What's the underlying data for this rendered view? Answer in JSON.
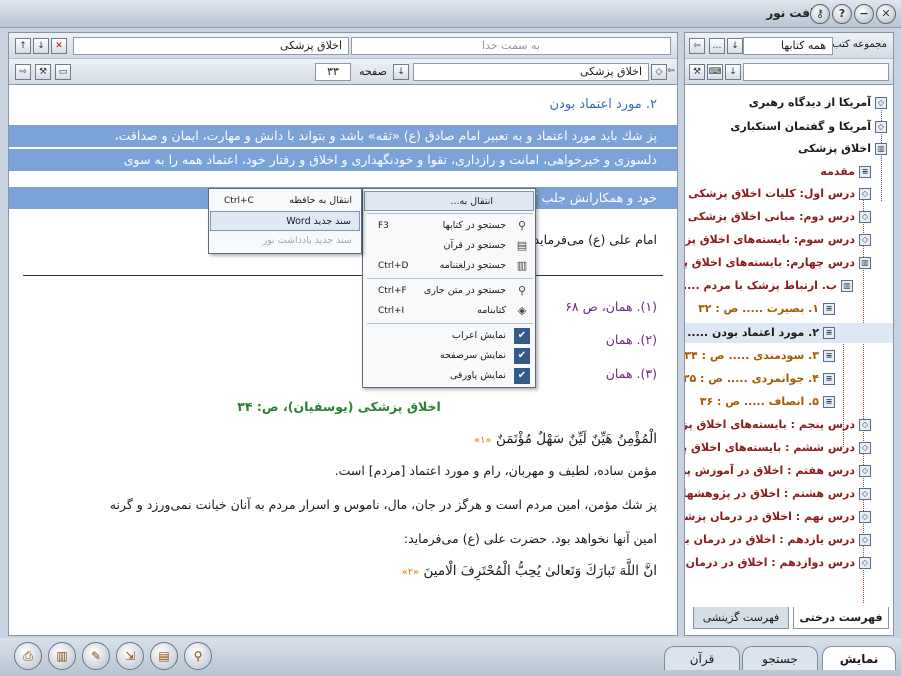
{
  "app": {
    "title": "ضیافت نور"
  },
  "reader": {
    "search_placeholder": "به سمت خدا",
    "book_title": "اخلاق پزشکی",
    "book_path": "اخلاق پزشکی",
    "page_label": "صفحه",
    "page_number": "۳۳"
  },
  "content": {
    "heading": "۲. مورد اعتماد بودن",
    "hl_line1": "پز شك بايد مورد اعتماد و به تعبير امام صادق (ع) «ثقه» باشد و بتواند با دانش و مهارت، ايمان و صداقت،",
    "hl_line2": "دلسوزى و خيرخواهى، امانت و رازدارى، تقوا و خودنگهدارى و اخلاق و رفتار خود، اعتماد همه را به سوى",
    "hl_line3": "خود و همكارانش جلب كند.",
    "line4": "امام على (ع) مى‌فرمايد:",
    "fn1": "(۱). همان، ص ۶۸",
    "fn2": "(۲). همان",
    "fn3": "(۳). همان",
    "source": "اخلاق پزشكى (يوسفيان)، ص: ۳۴",
    "arabic1": "الْمُؤْمِنُ هَيِّنٌ لَيِّنٌ سَهْلٌ مُؤْتَمَنٌ",
    "arabic1_ref": "«۱»",
    "para1": "مؤمن ساده، لطيف و مهربان، رام و مورد اعتماد [مردم] است.",
    "para2": "پز شك مؤمن، امين مردم است و هرگز در جان، مال، ناموس و اسرار مردم به آنان خيانت نمى‌ورزد و گرنه",
    "para3": "امين آنها نخواهد بود. حضرت على (ع) مى‌فرمايد:",
    "arabic2": "انَّ اللَّهَ تَبارَكَ وَتَعالىٰ يُحِبُّ الْمُحْتَرِفَ الْامينَ",
    "arabic2_ref": "«۲»"
  },
  "context_menu": {
    "goto": "انتقال به...",
    "search_books": "جستجو در کتابها",
    "search_books_key": "F3",
    "search_quran": "جستجو در قرآن",
    "search_dict": "جستجو درلغتنامه",
    "search_dict_key": "Ctrl+D",
    "search_current": "جستجو در متن جاری",
    "search_current_key": "Ctrl+F",
    "bookmark": "کتابنامه",
    "bookmark_key": "Ctrl+I",
    "show_arab": "نمایش اعراب",
    "show_header": "نمایش سرصفحه",
    "show_footnote": "نمایش پاورقی"
  },
  "submenu": {
    "copy": "انتقال به حافظه",
    "copy_key": "Ctrl+C",
    "word": "سند جدید Word",
    "note": "سند جدید یادداشت نور"
  },
  "library": {
    "header": "مجموعه کتب",
    "combo": "همه کتابها",
    "tree": [
      "آمریکا از دیدگاه رهبری",
      "آمریکا و گفتمان استکباری",
      "اخلاق پزشکی",
      "مقدمه",
      "درس اول: کلیات اخلاق پزشکی",
      "درس دوم: مبانی اخلاق پزشکی",
      "درس سوم: بایسته‌های اخلاق پزشکی",
      "درس چهارم: بایسته‌های اخلاق پزشکی",
      "ب. ارتباط پزشک با مردم ....",
      "۱. بصیرت ..... ص : ۳۲",
      "۲. مورد اعتماد بودن ..... ص : ۳۳",
      "۳. سودمندی ..... ص : ۳۴",
      "۴. جوانمردی ..... ص : ۳۵",
      "۵. انصاف ..... ص : ۳۶",
      "درس پنجم : بایسته‌های اخلاق پزشکی",
      "درس ششم : بایسته‌های اخلاق پزشکی",
      "درس هفتم : اخلاق در آموزش پزشکی",
      "درس هشتم : اخلاق در پژوهشهای",
      "درس نهم : اخلاق در درمان پزشکی",
      "درس یازدهم : اخلاق در درمان بیماران",
      "درس دوازدهم : اخلاق در درمان بیماران"
    ],
    "tab_tree": "فهرست درختی",
    "tab_index": "فهرست گزینشی"
  },
  "bottom_tabs": {
    "show": "نمایش",
    "search": "جستجو",
    "quran": "قرآن"
  }
}
